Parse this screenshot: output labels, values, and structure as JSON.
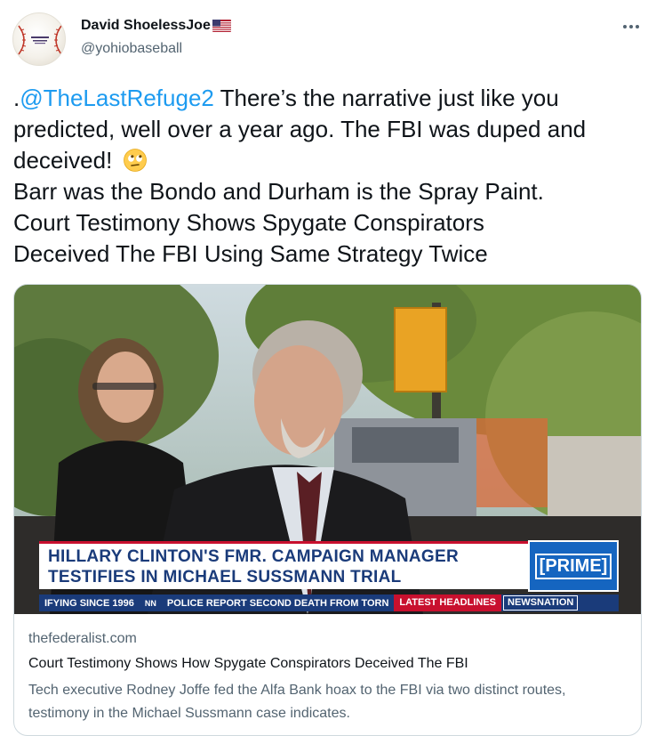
{
  "author": {
    "display_name": "David ShoelessJoe",
    "flag_emoji": "us-flag-icon",
    "handle": "@yohiobaseball",
    "avatar": "baseball-icon"
  },
  "more_label": "···",
  "tweet": {
    "lines": [
      {
        "mention": "@TheLastRefuge2",
        "prefix": ".",
        "text": " There’s the narrative just like you"
      },
      {
        "text": "predicted, well over a year ago. The FBI was duped and"
      },
      {
        "text": "deceived! ",
        "emoji": "face-with-rolling-eyes-icon"
      },
      {
        "text": "Barr was the Bondo and Durham is the Spray Paint."
      },
      {
        "text": "Court Testimony Shows Spygate Conspirators"
      },
      {
        "text": "Deceived The FBI Using Same Strategy Twice"
      }
    ]
  },
  "card": {
    "lower_third_line1": "HILLARY CLINTON'S FMR. CAMPAIGN MANAGER",
    "lower_third_line2": "TESTIFIES IN MICHAEL SUSSMANN TRIAL",
    "badge": "[PRIME]",
    "ticker": {
      "left": "IFYING SINCE 1996",
      "nn": "NN",
      "headline": "POLICE REPORT SECOND DEATH FROM TORN",
      "latest": "LATEST HEADLINES",
      "brand": "NEWSNATION"
    },
    "domain": "thefederalist.com",
    "title": "Court Testimony Shows How Spygate Conspirators Deceived The FBI",
    "description": "Tech executive Rodney Joffe fed the Alfa Bank hoax to the FBI via two distinct routes, testimony in the Michael Sussmann case indicates."
  },
  "colors": {
    "link": "#1d9bf0",
    "text": "#0f1419",
    "secondary": "#536471",
    "border": "#cfd9de",
    "lower_third_text": "#1a3b7a",
    "ticker_red": "#c8102e"
  }
}
